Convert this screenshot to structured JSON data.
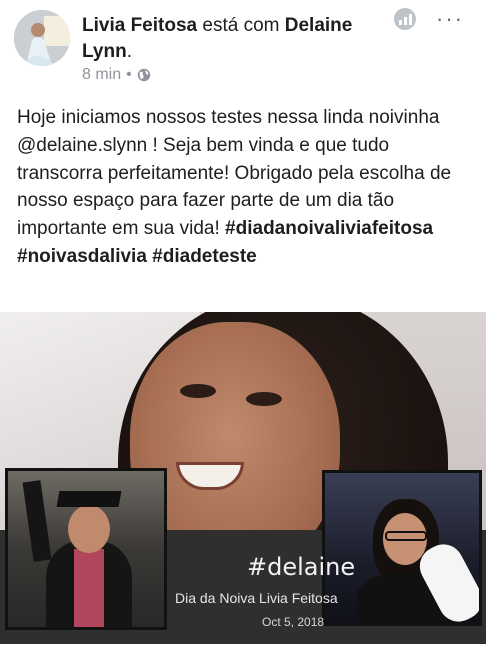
{
  "post": {
    "author": "Livia Feitosa",
    "connector": "está com",
    "tagged": "Delaine Lynn",
    "time": "8 min",
    "separator": "•",
    "privacy_icon": "globe-icon",
    "insights_icon": "insights-icon",
    "more_label": "···",
    "text": "Hoje iniciamos nossos testes nessa linda noivinha @delaine.slynn ! Seja bem vinda e que tudo transcorra perfeitamente! Obrigado pela escolha de nosso espaço para fazer parte de um dia tão importante em sua vida!",
    "hashtags": "#diadanoivaliviafeitosa #noivasdalivia #diadeteste"
  },
  "photo": {
    "hashtag": "#delaine",
    "caption": "Dia da Noiva Livia Feitosa",
    "date": "Oct 5, 2018"
  }
}
